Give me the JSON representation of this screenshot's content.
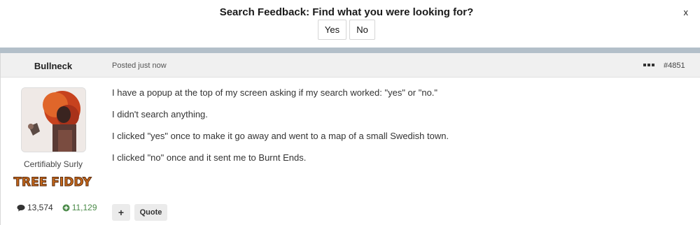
{
  "feedback": {
    "title": "Search Feedback: Find what you were looking for?",
    "yes_label": "Yes",
    "no_label": "No",
    "close_label": "x"
  },
  "post": {
    "username": "Bullneck",
    "posted": "Posted just now",
    "post_number": "#4851",
    "user_title": "Certifiably Surly",
    "banner_text": "TREE FIDDY",
    "message_count": "13,574",
    "reaction_count": "11,129",
    "body": [
      "I have a popup at the top of my screen asking if my search worked: \"yes\" or \"no.\"",
      "I didn't search anything.",
      "I clicked \"yes\" once to make it go away and went to a map of a small Swedish town.",
      "I clicked \"no\" once and it sent me to Burnt Ends."
    ],
    "actions": {
      "plus_label": "+",
      "quote_label": "Quote"
    }
  },
  "colors": {
    "divider": "#b3bfc9",
    "header_bg": "#f0f0f0",
    "reaction_green": "#4a8a48",
    "banner_orange": "#c86a1c"
  }
}
